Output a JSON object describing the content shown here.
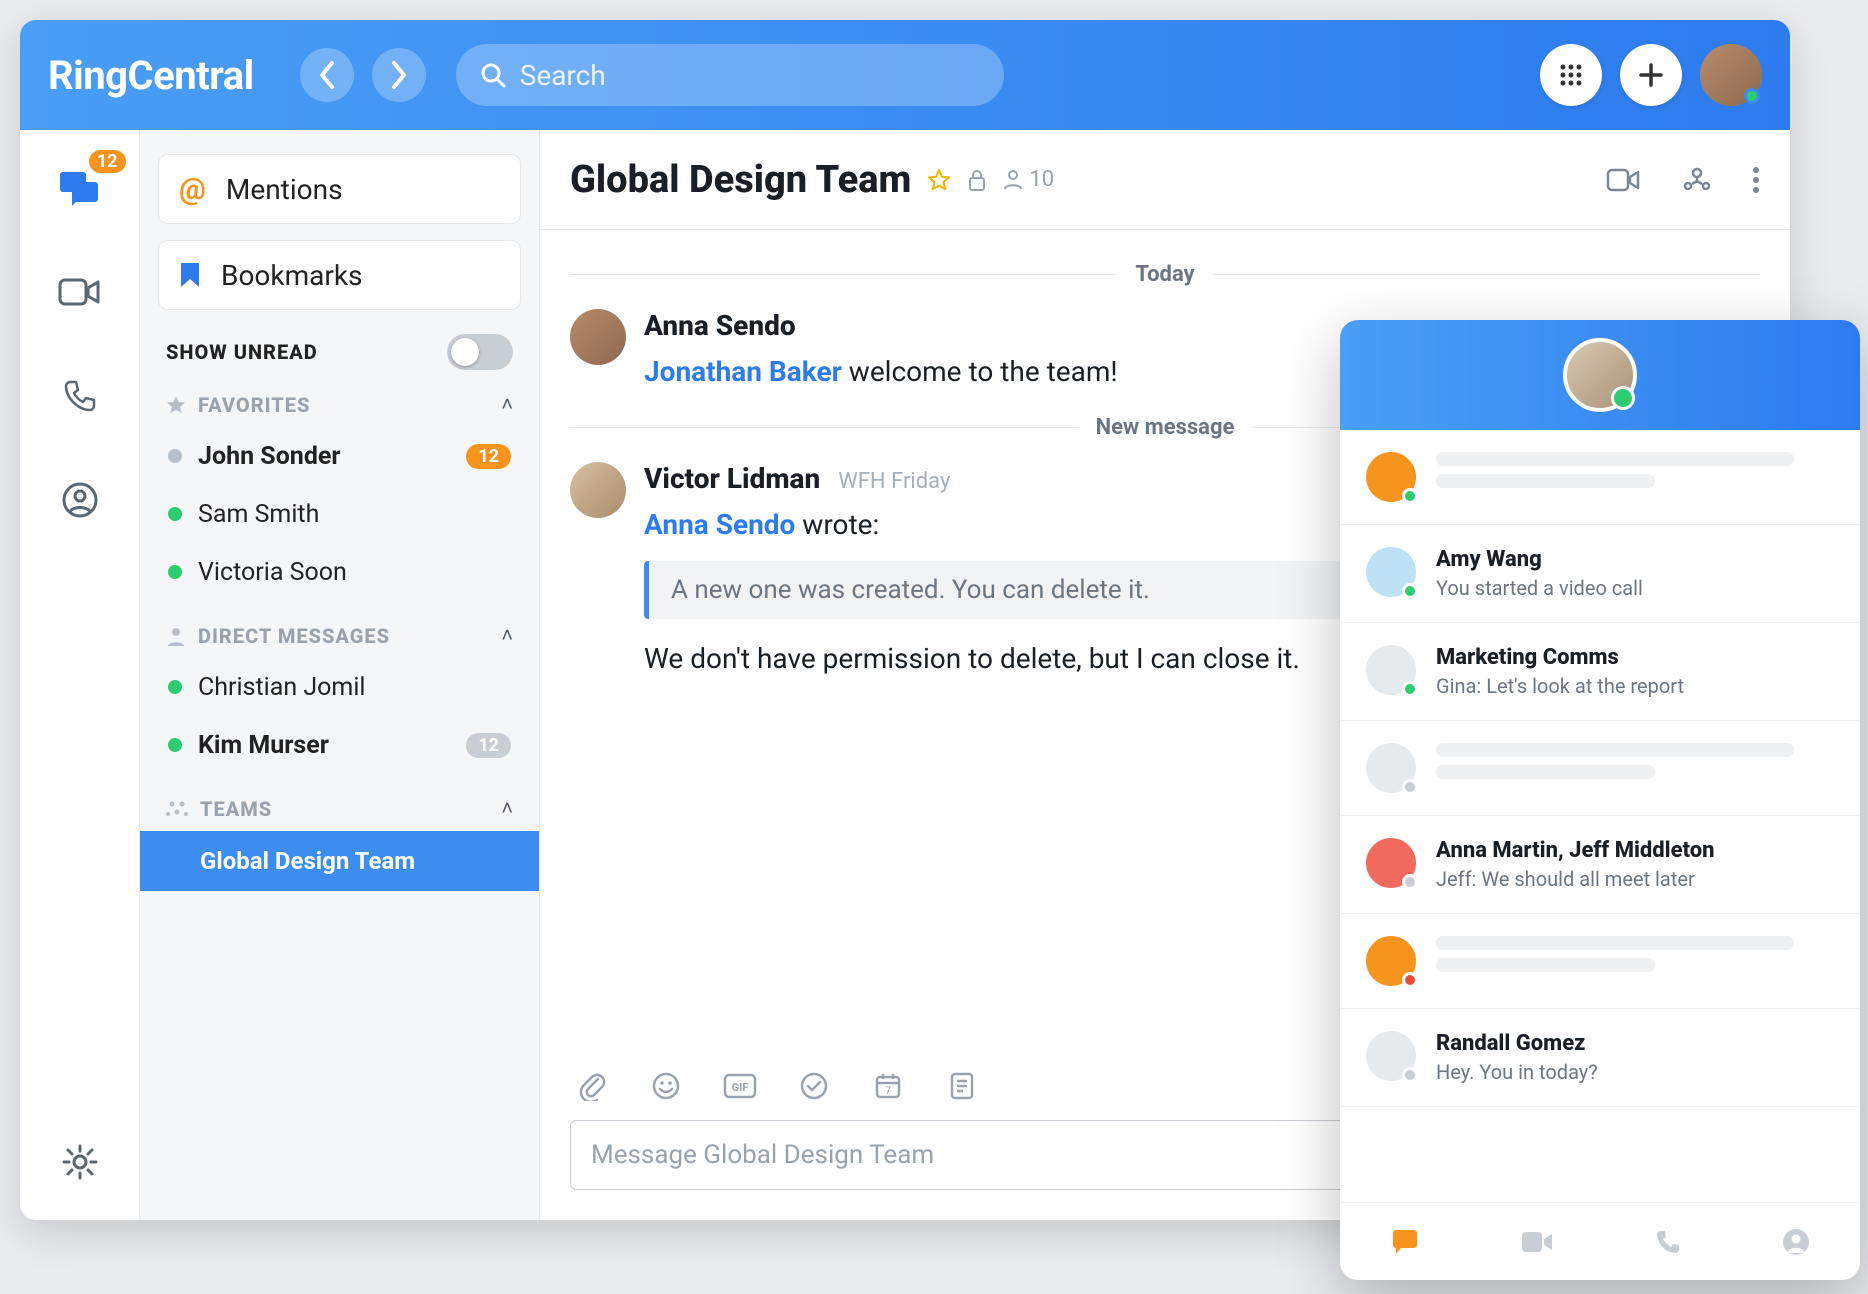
{
  "brand": "RingCentral",
  "search": {
    "placeholder": "Search"
  },
  "rail": {
    "messages_badge": "12"
  },
  "sidebar": {
    "mentions_label": "Mentions",
    "bookmarks_label": "Bookmarks",
    "show_unread_label": "SHOW UNREAD",
    "sections": {
      "favorites": {
        "label": "FAVORITES",
        "items": [
          {
            "name": "John Sonder",
            "presence": "grey",
            "bold": true,
            "badge": "12",
            "badge_style": "orange"
          },
          {
            "name": "Sam Smith",
            "presence": "green"
          },
          {
            "name": "Victoria Soon",
            "presence": "green"
          }
        ]
      },
      "direct_messages": {
        "label": "DIRECT MESSAGES",
        "items": [
          {
            "name": "Christian Jomil",
            "presence": "green"
          },
          {
            "name": "Kim Murser",
            "presence": "green",
            "bold": true,
            "badge": "12",
            "badge_style": "grey"
          }
        ]
      },
      "teams": {
        "label": "TEAMS",
        "active": "Global Design Team"
      }
    }
  },
  "chat": {
    "title": "Global Design Team",
    "member_count": "10",
    "today_label": "Today",
    "new_message_label": "New message",
    "messages": [
      {
        "author": "Anna Sendo",
        "mention": "Jonathan Baker",
        "after_mention": " welcome to the team!"
      },
      {
        "author": "Victor Lidman",
        "meta": "WFH Friday",
        "reply_prefix_mention": "Anna Sendo",
        "reply_suffix": " wrote:",
        "quote": "A new one was created. You can delete it.",
        "body": "We don't have permission to delete, but I can close it."
      }
    ],
    "composer_placeholder": "Message Global Design Team"
  },
  "popup": {
    "items": [
      {
        "type": "skeleton",
        "color": "#f7941e",
        "presence": "green"
      },
      {
        "type": "entry",
        "color": "#bfe1f5",
        "presence": "green",
        "name": "Amy Wang",
        "text": "You started a video call"
      },
      {
        "type": "entry",
        "color": "#e7eaed",
        "presence": "green",
        "name": "Marketing Comms",
        "text": "Gina: Let's look at the report"
      },
      {
        "type": "skeleton",
        "color": "#e7eaed",
        "presence": "grey"
      },
      {
        "type": "entry",
        "color": "#f06a5d",
        "presence": "grey",
        "name": "Anna Martin, Jeff Middleton",
        "text": "Jeff: We should all meet later"
      },
      {
        "type": "skeleton",
        "color": "#f7941e",
        "presence": "red"
      },
      {
        "type": "entry",
        "color": "#e7eaed",
        "presence": "grey",
        "name": "Randall Gomez",
        "text": "Hey. You in today?"
      }
    ]
  }
}
